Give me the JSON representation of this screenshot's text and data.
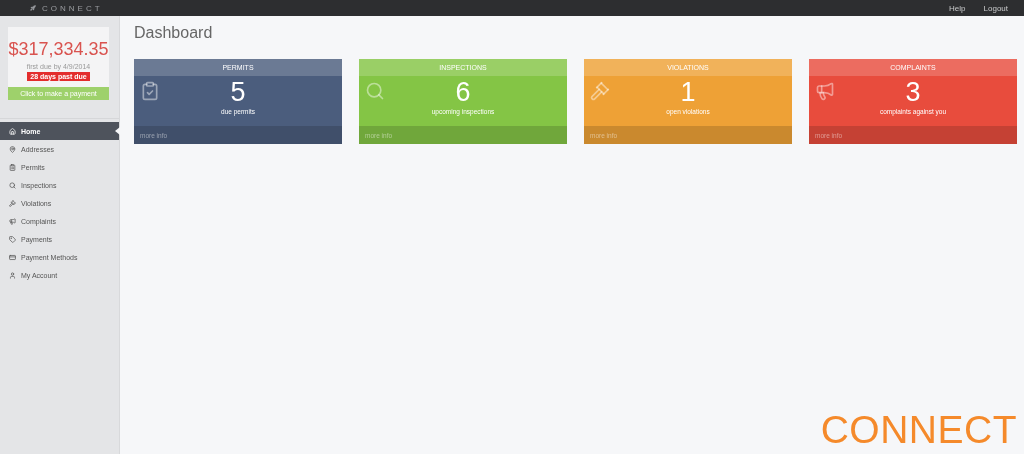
{
  "topbar": {
    "brand": "CONNECT",
    "links": [
      "Help",
      "Logout"
    ]
  },
  "balance": {
    "amount": "$317,334.35",
    "due": "first due by 4/9/2014",
    "badge": "28 days past due",
    "button": "Click to make a payment"
  },
  "sidebar": {
    "items": [
      {
        "label": "Home",
        "selected": true
      },
      {
        "label": "Addresses",
        "selected": false
      },
      {
        "label": "Permits",
        "selected": false
      },
      {
        "label": "Inspections",
        "selected": false
      },
      {
        "label": "Violations",
        "selected": false
      },
      {
        "label": "Complaints",
        "selected": false
      },
      {
        "label": "Payments",
        "selected": false
      },
      {
        "label": "Payment Methods",
        "selected": false
      },
      {
        "label": "My Account",
        "selected": false
      }
    ]
  },
  "page_title": "Dashboard",
  "cards": [
    {
      "title": "PERMITS",
      "count": "5",
      "caption": "due permits",
      "link": "more info",
      "color": "#4b5d7d"
    },
    {
      "title": "INSPECTIONS",
      "count": "6",
      "caption": "upcoming inspections",
      "link": "more info",
      "color": "#84c545"
    },
    {
      "title": "VIOLATIONS",
      "count": "1",
      "caption": "open violations",
      "link": "more info",
      "color": "#eea136"
    },
    {
      "title": "COMPLAINTS",
      "count": "3",
      "caption": "complaints against you",
      "link": "more info",
      "color": "#e84c3d"
    }
  ],
  "footer_logo": "CONNECT"
}
